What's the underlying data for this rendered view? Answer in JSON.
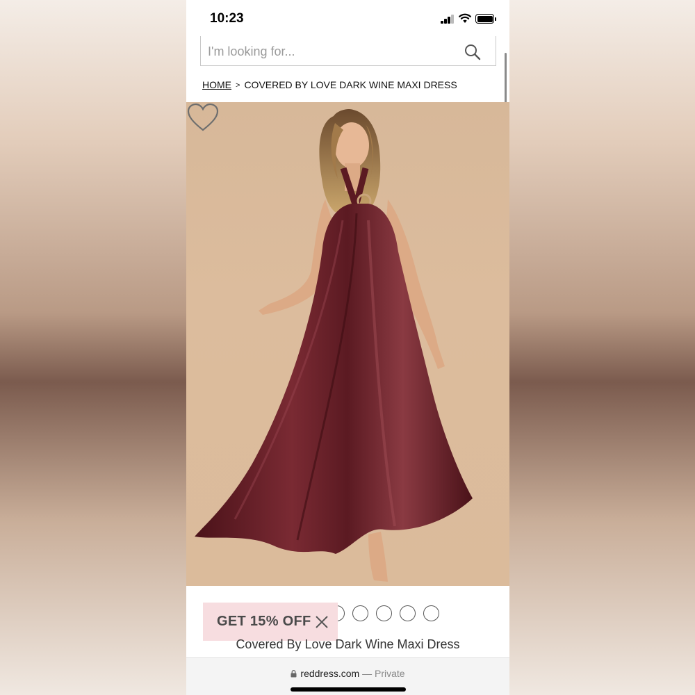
{
  "status_bar": {
    "time": "10:23"
  },
  "search": {
    "placeholder": "I'm looking for..."
  },
  "breadcrumb": {
    "home": "HOME",
    "separator": ">",
    "current": "COVERED BY LOVE DARK WINE MAXI DRESS"
  },
  "product": {
    "name": "Covered By Love Dark Wine Maxi Dress"
  },
  "promo": {
    "label": "GET 15% OFF"
  },
  "browser": {
    "domain": "reddress.com",
    "mode": "— Private"
  },
  "icons": [
    "search-icon",
    "heart-icon",
    "close-icon",
    "lock-icon",
    "signal-icon",
    "wifi-icon",
    "battery-icon"
  ],
  "colors": {
    "dress": "#5b1a22",
    "background": "#d9b999",
    "promo_bg": "#f7dde0"
  }
}
